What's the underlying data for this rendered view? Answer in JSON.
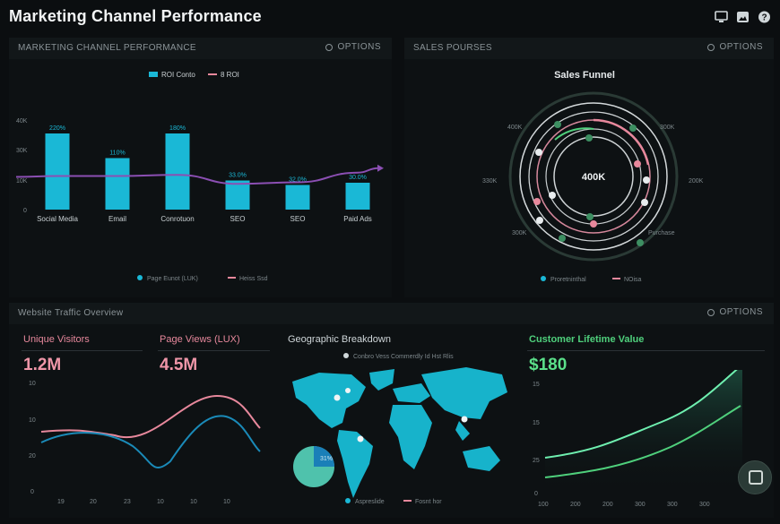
{
  "app": {
    "title": "Marketing Channel Performance"
  },
  "header_icons": [
    "monitor-icon",
    "image-icon",
    "help-icon"
  ],
  "colors": {
    "cyan": "#1ab8d6",
    "pink": "#e7889c",
    "purple": "#8b4fb3",
    "green": "#4fd07c",
    "teal": "#2a9fb0"
  },
  "panels": {
    "channel": {
      "title": "MARKETING CHANNEL PERFORMANCE",
      "options": "OPTIONS"
    },
    "sales": {
      "title": "SALES POURSES",
      "options": "OPTIONS"
    },
    "traffic": {
      "title": "Website Traffic Overview",
      "options": "OPTIONS"
    }
  },
  "channel_chart": {
    "legend": [
      "ROI Conto",
      "8 ROI"
    ],
    "bottom_legend": [
      "Page Eunot (LUK)",
      "Heiss Ssd"
    ],
    "yticks": [
      "40K",
      "30K",
      "10K",
      "0"
    ],
    "bar_labels": [
      "220%",
      "110%",
      "180%",
      "33.0%",
      "32.0%",
      "30.0%"
    ]
  },
  "sales_funnel": {
    "title": "Sales Funnel",
    "center_label": "400K",
    "labels": [
      "400K",
      "300K",
      "330K",
      "200K",
      "300K",
      "Purchase"
    ],
    "legend": [
      "Proretninthal",
      "NOisa"
    ]
  },
  "metrics": {
    "unique_visitors": {
      "title": "Unique Visitors",
      "value": "1.2M"
    },
    "page_views": {
      "title": "Page Views (LUX)",
      "value": "4.5M"
    },
    "ltv": {
      "title": "Customer Lifetime Value",
      "value": "$180"
    }
  },
  "traffic_chart": {
    "yticks": [
      "10",
      "10",
      "20",
      "0"
    ],
    "xticks": [
      "19",
      "20",
      "23",
      "10",
      "10",
      "10"
    ]
  },
  "geo": {
    "title": "Geographic Breakdown",
    "legend_top": "Conbro Vess Commerdly Id Hst Rlis",
    "pie_label": "31%",
    "legend_bottom": [
      "Aspreslide",
      "Fosnt hor"
    ]
  },
  "ltv_chart": {
    "yticks": [
      "15",
      "15",
      "25",
      "0"
    ],
    "xticks": [
      "100",
      "200",
      "200",
      "300",
      "300",
      "300"
    ]
  },
  "chart_data": [
    {
      "type": "bar",
      "categories": [
        "Social Media",
        "Email",
        "Conrotuon",
        "SEO",
        "SEO",
        "Paid Ads"
      ],
      "series": [
        {
          "name": "ROI Conto",
          "values": [
            34,
            23,
            34,
            13,
            11,
            12
          ]
        },
        {
          "name": "8 ROI",
          "values": [
            15,
            15,
            15.5,
            11.5,
            12.2,
            16.5
          ]
        }
      ],
      "yticks": [
        "40K",
        "30K",
        "10K",
        "0"
      ],
      "data_labels": [
        "220%",
        "110%",
        "180%",
        "33.0%",
        "32.0%",
        "30.0%"
      ]
    }
  ]
}
